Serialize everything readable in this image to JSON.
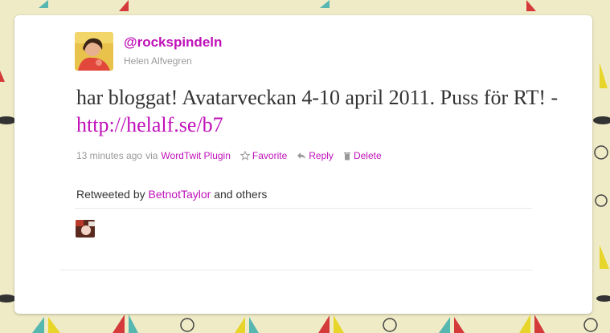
{
  "tweet": {
    "username": "@rockspindeln",
    "real_name": "Helen Alfvegren",
    "text": "har bloggat! Avatarveckan 4-10 april 2011. Puss för RT! - ",
    "link": "http://helalf.se/b7",
    "timestamp": "13 minutes ago",
    "via_label": "via",
    "client": "WordTwit Plugin",
    "actions": {
      "favorite": "Favorite",
      "reply": "Reply",
      "delete": "Delete"
    }
  },
  "retweets": {
    "prefix": "Retweeted by",
    "user": "BetnotTaylor",
    "suffix": "and others"
  },
  "colors": {
    "link": "#c011b9",
    "background": "#efebc6",
    "card": "#ffffff"
  },
  "icons": {
    "favorite": "star-icon",
    "reply": "reply-arrow-icon",
    "delete": "trash-icon"
  }
}
